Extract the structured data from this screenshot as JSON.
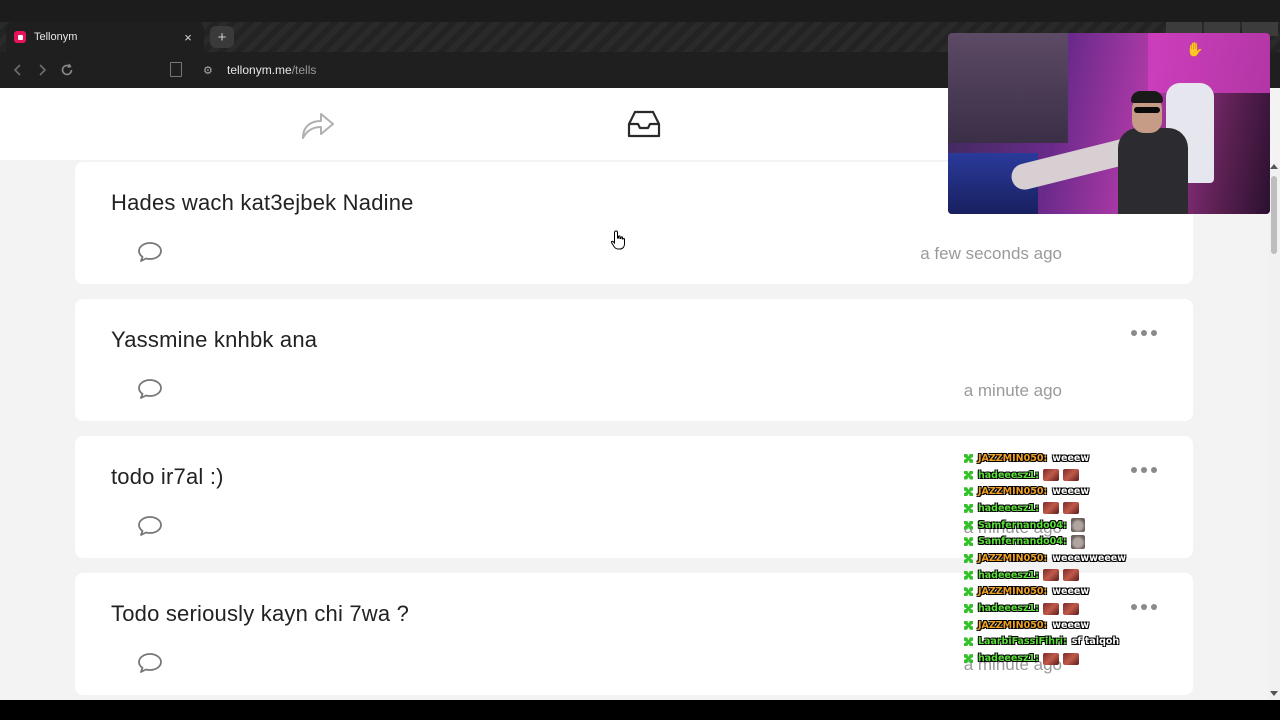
{
  "browser": {
    "tab_title": "Tellonym",
    "tab_close": "×",
    "new_tab": "+",
    "url_host": "tellonym.me",
    "url_path": "/tells"
  },
  "icons": {
    "back": "arrow-left-icon",
    "forward": "arrow-right-icon",
    "reload": "reload-icon",
    "share": "share-arrow-icon",
    "inbox": "inbox-icon",
    "comment": "comment-bubble-icon",
    "more": "more-dots-icon"
  },
  "tells": [
    {
      "text": "Hades wach kat3ejbek Nadine",
      "time": "a few seconds ago"
    },
    {
      "text": "Yassmine knhbk ana",
      "time": "a minute ago"
    },
    {
      "text": "todo ir7al :)",
      "time": "a minute ago"
    },
    {
      "text": "Todo seriously kayn chi 7wa ?",
      "time": "a minute ago"
    }
  ],
  "colors": {
    "brand": "#e4135a",
    "chat_orange": "#f0a020",
    "chat_green": "#5ce03a"
  },
  "chat": [
    {
      "user": "JAZZMIN050:",
      "color": "#f0a020",
      "msg": "weeew",
      "emotes": 0
    },
    {
      "user": "hadeeesz1:",
      "color": "#5ce03a",
      "msg": "",
      "emotes": 2
    },
    {
      "user": "JAZZMIN050:",
      "color": "#f0a020",
      "msg": "weeew",
      "emotes": 0
    },
    {
      "user": "hadeeesz1:",
      "color": "#5ce03a",
      "msg": "",
      "emotes": 2
    },
    {
      "user": "Samfernando04:",
      "color": "#5ce03a",
      "msg": "",
      "emotes": 1
    },
    {
      "user": "Samfernando04:",
      "color": "#5ce03a",
      "msg": "",
      "emotes": 1
    },
    {
      "user": "JAZZMIN050:",
      "color": "#f0a020",
      "msg": "weeewweeew",
      "emotes": 0
    },
    {
      "user": "hadeeesz1:",
      "color": "#5ce03a",
      "msg": "",
      "emotes": 2
    },
    {
      "user": "JAZZMIN050:",
      "color": "#f0a020",
      "msg": "weeew",
      "emotes": 0
    },
    {
      "user": "hadeeesz1:",
      "color": "#5ce03a",
      "msg": "",
      "emotes": 2
    },
    {
      "user": "JAZZMIN050:",
      "color": "#f0a020",
      "msg": "weeew",
      "emotes": 0
    },
    {
      "user": "LaarbiFassiFihri:",
      "color": "#5ce03a",
      "msg": "sf talqoh",
      "emotes": 0
    },
    {
      "user": "hadeeesz1:",
      "color": "#5ce03a",
      "msg": "",
      "emotes": 2
    }
  ]
}
